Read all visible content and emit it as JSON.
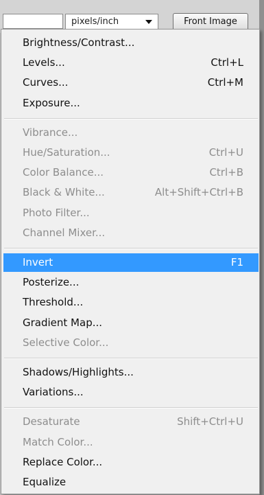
{
  "options_bar": {
    "units_value": "pixels/inch",
    "front_image_label": "Front Image"
  },
  "menu": {
    "groups": [
      [
        {
          "label": "Brightness/Contrast...",
          "shortcut": "",
          "enabled": true
        },
        {
          "label": "Levels...",
          "shortcut": "Ctrl+L",
          "enabled": true
        },
        {
          "label": "Curves...",
          "shortcut": "Ctrl+M",
          "enabled": true
        },
        {
          "label": "Exposure...",
          "shortcut": "",
          "enabled": true
        }
      ],
      [
        {
          "label": "Vibrance...",
          "shortcut": "",
          "enabled": false
        },
        {
          "label": "Hue/Saturation...",
          "shortcut": "Ctrl+U",
          "enabled": false
        },
        {
          "label": "Color Balance...",
          "shortcut": "Ctrl+B",
          "enabled": false
        },
        {
          "label": "Black & White...",
          "shortcut": "Alt+Shift+Ctrl+B",
          "enabled": false
        },
        {
          "label": "Photo Filter...",
          "shortcut": "",
          "enabled": false
        },
        {
          "label": "Channel Mixer...",
          "shortcut": "",
          "enabled": false
        }
      ],
      [
        {
          "label": "Invert",
          "shortcut": "F1",
          "enabled": true,
          "highlighted": true
        },
        {
          "label": "Posterize...",
          "shortcut": "",
          "enabled": true
        },
        {
          "label": "Threshold...",
          "shortcut": "",
          "enabled": true
        },
        {
          "label": "Gradient Map...",
          "shortcut": "",
          "enabled": true
        },
        {
          "label": "Selective Color...",
          "shortcut": "",
          "enabled": false
        }
      ],
      [
        {
          "label": "Shadows/Highlights...",
          "shortcut": "",
          "enabled": true
        },
        {
          "label": "Variations...",
          "shortcut": "",
          "enabled": true
        }
      ],
      [
        {
          "label": "Desaturate",
          "shortcut": "Shift+Ctrl+U",
          "enabled": false
        },
        {
          "label": "Match Color...",
          "shortcut": "",
          "enabled": false
        },
        {
          "label": "Replace Color...",
          "shortcut": "",
          "enabled": true
        },
        {
          "label": "Equalize",
          "shortcut": "",
          "enabled": true
        }
      ]
    ]
  },
  "colors": {
    "highlight": "#3399ff",
    "disabled_text": "#8d8d8d",
    "menu_background": "#f0f0f0"
  }
}
